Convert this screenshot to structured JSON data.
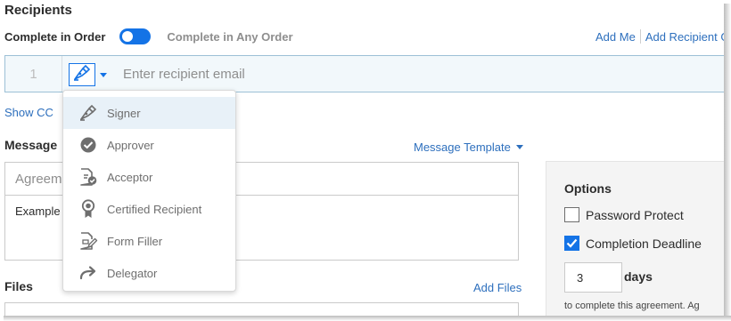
{
  "recipients": {
    "title": "Recipients",
    "complete_in_order": "Complete in Order",
    "complete_any_order": "Complete in Any Order",
    "add_me": "Add Me",
    "add_recipient_group": "Add Recipient G",
    "row_number": "1",
    "email_placeholder": "Enter recipient email",
    "show_cc": "Show CC"
  },
  "role_menu": {
    "items": [
      {
        "label": "Signer",
        "icon": "pen-icon"
      },
      {
        "label": "Approver",
        "icon": "check-circle-icon"
      },
      {
        "label": "Acceptor",
        "icon": "document-check-icon"
      },
      {
        "label": "Certified Recipient",
        "icon": "ribbon-icon"
      },
      {
        "label": "Form Filler",
        "icon": "form-edit-icon"
      },
      {
        "label": "Delegator",
        "icon": "forward-arrow-icon"
      }
    ]
  },
  "message": {
    "title": "Message",
    "template_link": "Message Template",
    "subject_partial": "Agreem",
    "body_partial": "Example"
  },
  "files": {
    "title": "Files",
    "add_files": "Add Files"
  },
  "options": {
    "title": "Options",
    "password_protect": "Password Protect",
    "completion_deadline": "Completion Deadline",
    "days_value": "3",
    "days_label": "days",
    "note": "to complete this agreement. Ag"
  },
  "colors": {
    "accent": "#1473e6",
    "link": "#2d6fbd",
    "menu_highlight": "#e8f1f8"
  }
}
